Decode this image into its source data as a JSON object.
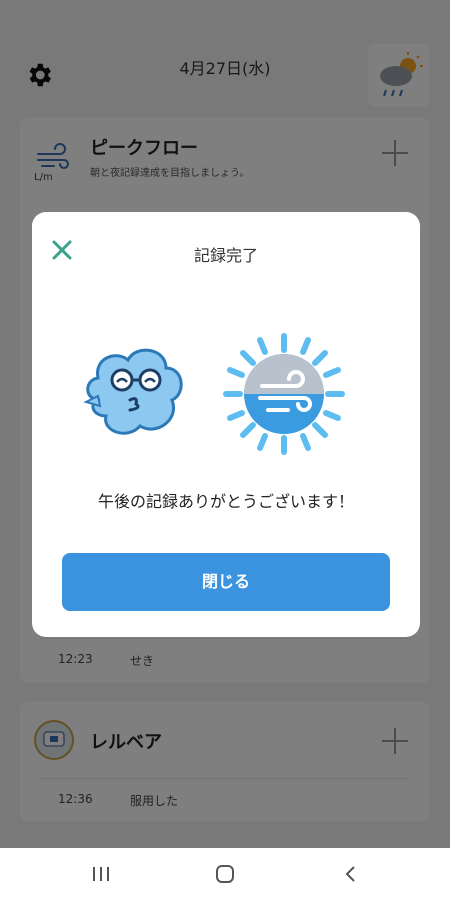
{
  "header": {
    "date": "4月27日(水)",
    "settings_icon": "gear-icon",
    "weather_icon": "rain-sun-weather-icon"
  },
  "peak_flow_card": {
    "title": "ピークフロー",
    "subtitle": "朝と夜記録達成を目指しましょう。",
    "unit": "L/m",
    "entry": {
      "time": "12:23",
      "label": "せき"
    }
  },
  "relvar_card": {
    "title": "レルベア",
    "entry": {
      "time": "12:36",
      "label": "服用した"
    }
  },
  "dialog": {
    "title": "記録完了",
    "message": "午後の記録ありがとうございます！",
    "close_button": "閉じる"
  },
  "colors": {
    "accent": "#3b92de",
    "close_icon": "#3aa38a",
    "overlay": "rgba(0,0,0,0.5)"
  }
}
